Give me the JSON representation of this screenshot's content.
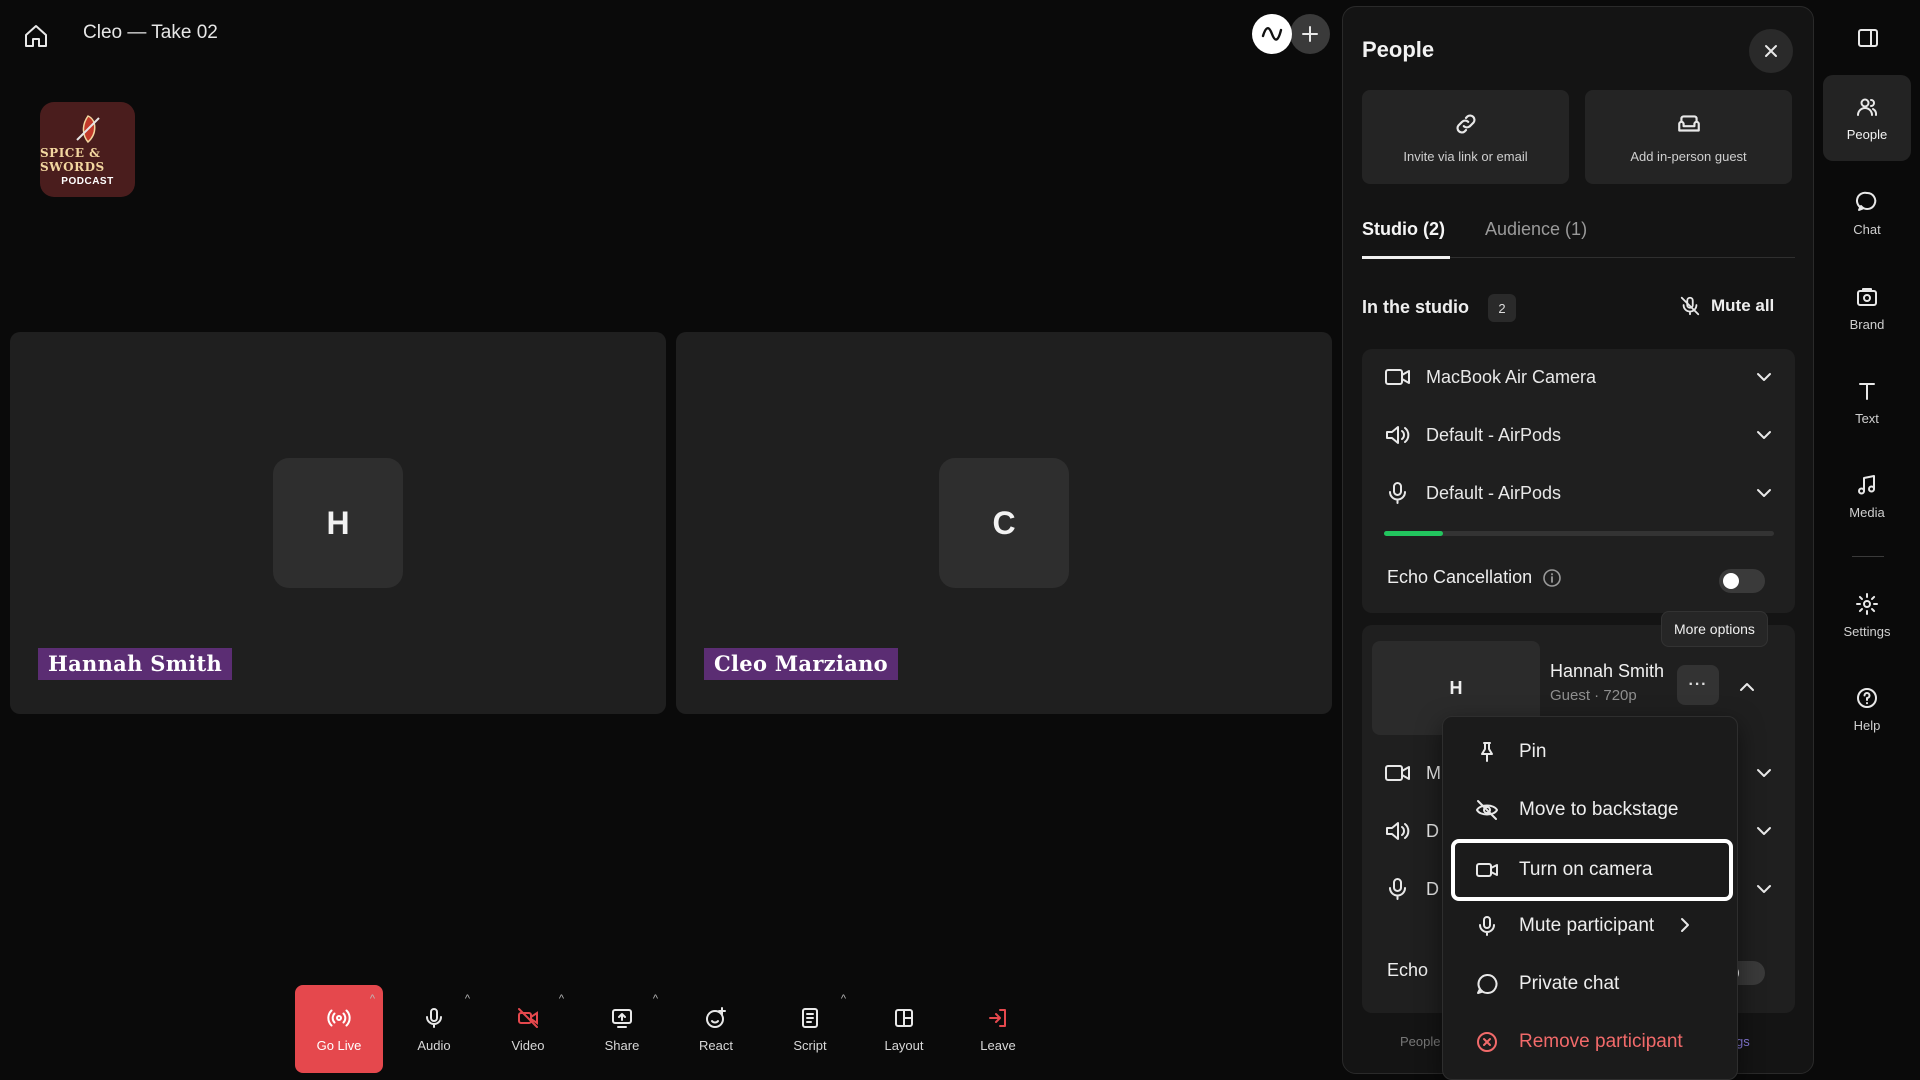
{
  "window": {
    "title": "Cleo — Take 02"
  },
  "logo": {
    "line1": "SPICE & SWORDS",
    "line2": "PODCAST"
  },
  "stage": {
    "tiles": [
      {
        "initial": "H",
        "name": "Hannah Smith"
      },
      {
        "initial": "C",
        "name": "Cleo Marziano"
      }
    ]
  },
  "toolbar": {
    "go_live": "Go Live",
    "audio": "Audio",
    "video": "Video",
    "share": "Share",
    "react": "React",
    "script": "Script",
    "layout": "Layout",
    "leave": "Leave"
  },
  "panel": {
    "title": "People",
    "invite_label": "Invite via link or email",
    "add_guest_label": "Add in-person guest",
    "tabs": [
      {
        "label": "Studio (2)"
      },
      {
        "label": "Audience (1)"
      }
    ],
    "in_studio_label": "In the studio",
    "in_studio_count": "2",
    "mute_all": "Mute all",
    "devices": {
      "camera": "MacBook Air Camera",
      "speaker": "Default - AirPods",
      "mic": "Default - AirPods"
    },
    "echo_label": "Echo Cancellation",
    "echo_enabled": false,
    "mic_level": 0.15,
    "participant": {
      "initial": "H",
      "name": "Hannah Smith",
      "subtitle": "Guest · 720p",
      "camera_trunc": "M",
      "speaker_trunc": "D",
      "mic_trunc": "D",
      "echo_trunc": "Echo"
    },
    "tooltip": "More options",
    "footer_left": "People",
    "footer_right": "gs"
  },
  "menu": {
    "items": [
      {
        "label": "Pin"
      },
      {
        "label": "Move to backstage"
      },
      {
        "label": "Turn on camera"
      },
      {
        "label": "Mute participant"
      },
      {
        "label": "Private chat"
      },
      {
        "label": "Remove participant"
      }
    ]
  },
  "rail": {
    "items": [
      {
        "label": "People"
      },
      {
        "label": "Chat"
      },
      {
        "label": "Brand"
      },
      {
        "label": "Text"
      },
      {
        "label": "Media"
      },
      {
        "label": "Settings"
      },
      {
        "label": "Help"
      }
    ]
  },
  "colors": {
    "go_live": "#e5484d",
    "name_tag": "#5b2d73",
    "danger": "#f16a6a",
    "meter": "#22c55e"
  }
}
